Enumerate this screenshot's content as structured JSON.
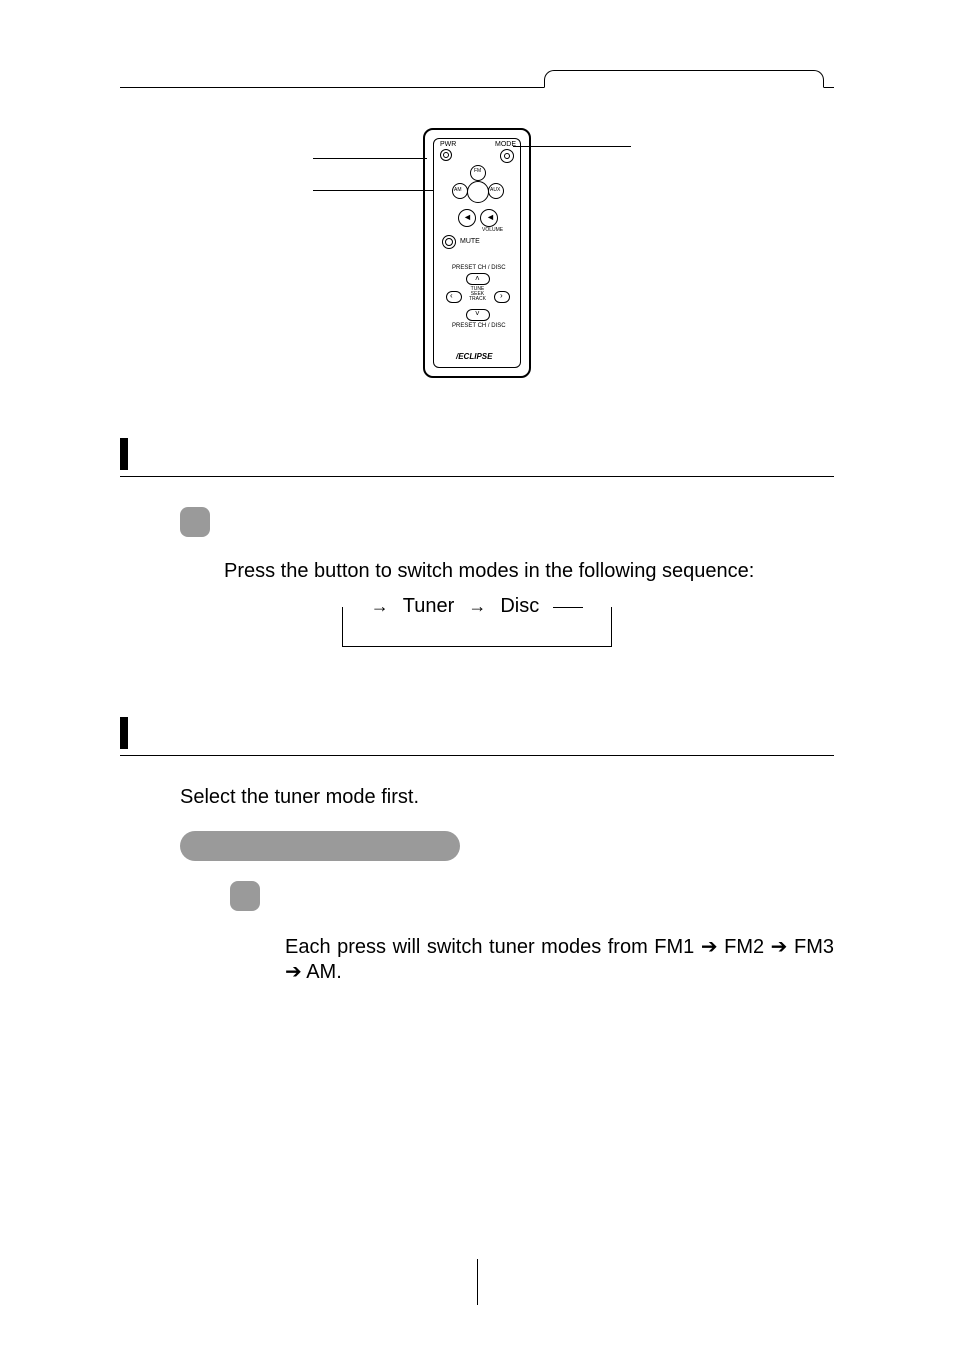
{
  "remote": {
    "top_left_label": "PWR",
    "top_right_label": "MODE",
    "cluster": {
      "left": "AM",
      "top": "FM",
      "right": "AUX"
    },
    "vol_label": "VOLUME",
    "mute_label": "MUTE",
    "preset_up_label": "PRESET CH / DISC",
    "seek_label": "TUNE\nSEEK\nTRACK",
    "preset_down_label": "PRESET CH / DISC",
    "brand": "/ECLIPSE"
  },
  "section_mode": {
    "instruction": "Press the button to switch modes in the following sequence:",
    "cycle": {
      "a": "Tuner",
      "b": "Disc"
    }
  },
  "section_tuner": {
    "intro": "Select the tuner mode first.",
    "instruction": "Each press will switch tuner modes from FM1 ➔ FM2 ➔ FM3 ➔ AM."
  }
}
